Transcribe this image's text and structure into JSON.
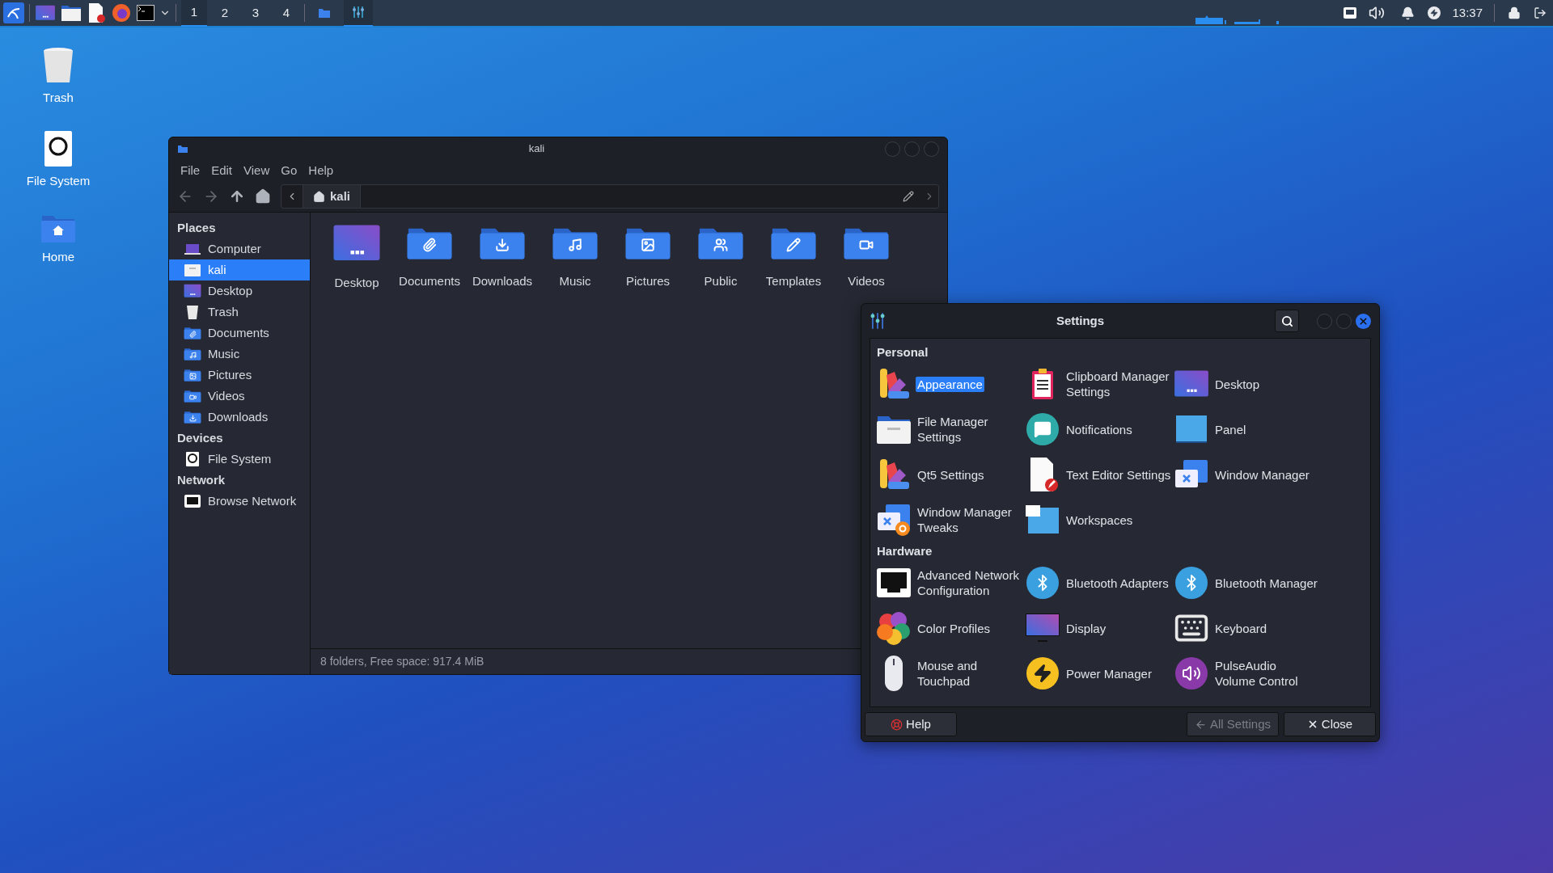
{
  "panel": {
    "workspaces": [
      {
        "label": "1",
        "selected": true
      },
      {
        "label": "2",
        "selected": false
      },
      {
        "label": "3",
        "selected": false
      },
      {
        "label": "4",
        "selected": false
      }
    ],
    "tasks": [
      {
        "selected": false
      },
      {
        "selected": true
      }
    ],
    "clock": "13:37"
  },
  "desktop_icons": [
    {
      "label": "Trash"
    },
    {
      "label": "File System"
    },
    {
      "label": "Home"
    }
  ],
  "file_manager": {
    "title": "kali",
    "menu": [
      "File",
      "Edit",
      "View",
      "Go",
      "Help"
    ],
    "path": "kali",
    "sidebar": [
      {
        "heading": "Places",
        "items": [
          {
            "label": "Computer",
            "selected": false
          },
          {
            "label": "kali",
            "selected": true
          },
          {
            "label": "Desktop",
            "selected": false
          },
          {
            "label": "Trash",
            "selected": false
          },
          {
            "label": "Documents",
            "selected": false
          },
          {
            "label": "Music",
            "selected": false
          },
          {
            "label": "Pictures",
            "selected": false
          },
          {
            "label": "Videos",
            "selected": false
          },
          {
            "label": "Downloads",
            "selected": false
          }
        ]
      },
      {
        "heading": "Devices",
        "items": [
          {
            "label": "File System",
            "selected": false
          }
        ]
      },
      {
        "heading": "Network",
        "items": [
          {
            "label": "Browse Network",
            "selected": false
          }
        ]
      }
    ],
    "folders": [
      "Desktop",
      "Documents",
      "Downloads",
      "Music",
      "Pictures",
      "Public",
      "Templates",
      "Videos"
    ],
    "status": "8 folders, Free space: 917.4 MiB"
  },
  "settings": {
    "title": "Settings",
    "sections": [
      {
        "heading": "Personal",
        "items": [
          {
            "label": "Appearance",
            "selected": true
          },
          {
            "label": "Clipboard Manager Settings",
            "selected": false
          },
          {
            "label": "Desktop",
            "selected": false
          },
          {
            "label": "File Manager Settings",
            "selected": false
          },
          {
            "label": "Notifications",
            "selected": false
          },
          {
            "label": "Panel",
            "selected": false
          },
          {
            "label": "Qt5 Settings",
            "selected": false
          },
          {
            "label": "Text Editor Settings",
            "selected": false
          },
          {
            "label": "Window Manager",
            "selected": false
          },
          {
            "label": "Window Manager Tweaks",
            "selected": false
          },
          {
            "label": "Workspaces",
            "selected": false
          }
        ]
      },
      {
        "heading": "Hardware",
        "items": [
          {
            "label": "Advanced Network Configuration",
            "selected": false
          },
          {
            "label": "Bluetooth Adapters",
            "selected": false
          },
          {
            "label": "Bluetooth Manager",
            "selected": false
          },
          {
            "label": "Color Profiles",
            "selected": false
          },
          {
            "label": "Display",
            "selected": false
          },
          {
            "label": "Keyboard",
            "selected": false
          },
          {
            "label": "Mouse and Touchpad",
            "selected": false
          },
          {
            "label": "Power Manager",
            "selected": false
          },
          {
            "label": "PulseAudio Volume Control",
            "selected": false
          }
        ]
      }
    ],
    "buttons": [
      {
        "label": "Help",
        "disabled": false
      },
      {
        "label": "All Settings",
        "disabled": true
      },
      {
        "label": "Close",
        "disabled": false
      }
    ]
  }
}
